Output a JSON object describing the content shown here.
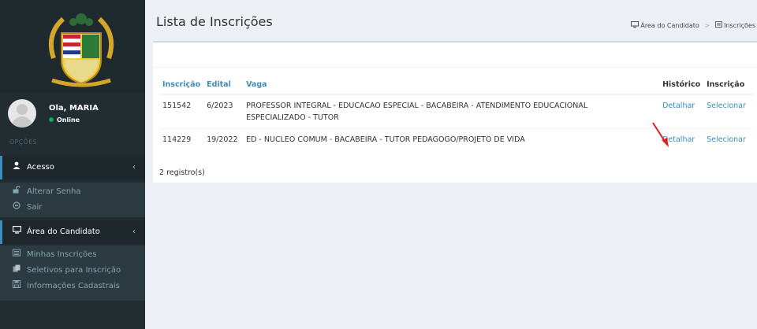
{
  "sidebar": {
    "user": {
      "name": "Ola, MARIA",
      "status": "Online"
    },
    "section_header": "OPÇÕES",
    "menus": [
      {
        "label": "Acesso",
        "icon": "user-icon",
        "items": [
          {
            "label": "Alterar Senha",
            "icon": "unlock-icon"
          },
          {
            "label": "Sair",
            "icon": "power-icon"
          }
        ]
      },
      {
        "label": "Área do Candidato",
        "icon": "monitor-icon",
        "items": [
          {
            "label": "Minhas Inscrições",
            "icon": "list-icon"
          },
          {
            "label": "Seletivos para Inscrição",
            "icon": "copy-icon"
          },
          {
            "label": "Informações Cadastrais",
            "icon": "save-icon"
          }
        ]
      }
    ]
  },
  "header": {
    "title": "Lista de Inscrições",
    "breadcrumb": [
      "Área do Candidato",
      "Inscrições"
    ]
  },
  "table": {
    "columns": [
      "Inscrição",
      "Edital",
      "Vaga",
      "Histórico",
      "Inscrição"
    ],
    "rows": [
      {
        "inscricao": "151542",
        "edital": "6/2023",
        "vaga": "PROFESSOR INTEGRAL - EDUCACAO ESPECIAL - BACABEIRA - ATENDIMENTO EDUCACIONAL ESPECIALIZADO - TUTOR",
        "historico": "Detalhar",
        "acao": "Selecionar"
      },
      {
        "inscricao": "114229",
        "edital": "19/2022",
        "vaga": "ED - NUCLEO COMUM - BACABEIRA - TUTOR PEDAGOGO/PROJETO DE VIDA",
        "historico": "Detalhar",
        "acao": "Selecionar"
      }
    ],
    "count_label": "2 registro(s)"
  },
  "colors": {
    "sidebar": "#222d32",
    "accent": "#3c8dbc",
    "arrow": "#e02020"
  }
}
